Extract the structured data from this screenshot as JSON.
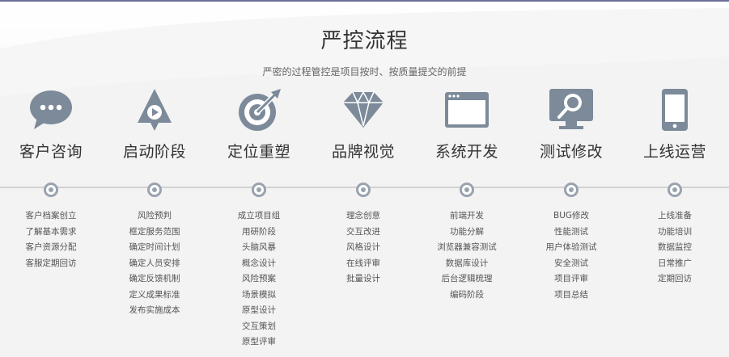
{
  "header": {
    "title": "严控流程",
    "subtitle": "严密的过程管控是项目按时、按质量提交的前提"
  },
  "colors": {
    "icon": "#7c8a99",
    "accent": "#6b6f9a",
    "timeline": "#d2d2d2"
  },
  "steps": [
    {
      "title": "客户咨询",
      "icon": "chat-bubble-icon",
      "items": [
        "客户档案创立",
        "了解基本需求",
        "客户资源分配",
        "客服定期回访"
      ]
    },
    {
      "title": "启动阶段",
      "icon": "launch-icon",
      "items": [
        "风险预判",
        "框定服务范围",
        "确定时间计划",
        "确定人员安排",
        "确定反馈机制",
        "定义成果标准",
        "发布实施成本"
      ]
    },
    {
      "title": "定位重塑",
      "icon": "target-icon",
      "items": [
        "成立项目组",
        "用研阶段",
        "头脑风暴",
        "概念设计",
        "风险预案",
        "场景模拟",
        "原型设计",
        "交互策划",
        "原型评审"
      ]
    },
    {
      "title": "品牌视觉",
      "icon": "diamond-icon",
      "items": [
        "理念创意",
        "交互改进",
        "风格设计",
        "在线评审",
        "批量设计"
      ]
    },
    {
      "title": "系统开发",
      "icon": "browser-window-icon",
      "items": [
        "前端开发",
        "功能分解",
        "浏览器兼容测试",
        "数据库设计",
        "后台逻辑梳理",
        "编码阶段"
      ]
    },
    {
      "title": "测试修改",
      "icon": "magnifier-icon",
      "items": [
        "BUG修改",
        "性能测试",
        "用户体验测试",
        "安全测试",
        "项目评审",
        "项目总结"
      ]
    },
    {
      "title": "上线运营",
      "icon": "mobile-phone-icon",
      "items": [
        "上线准备",
        "功能培训",
        "数据监控",
        "日常推广",
        "定期回访"
      ]
    }
  ]
}
